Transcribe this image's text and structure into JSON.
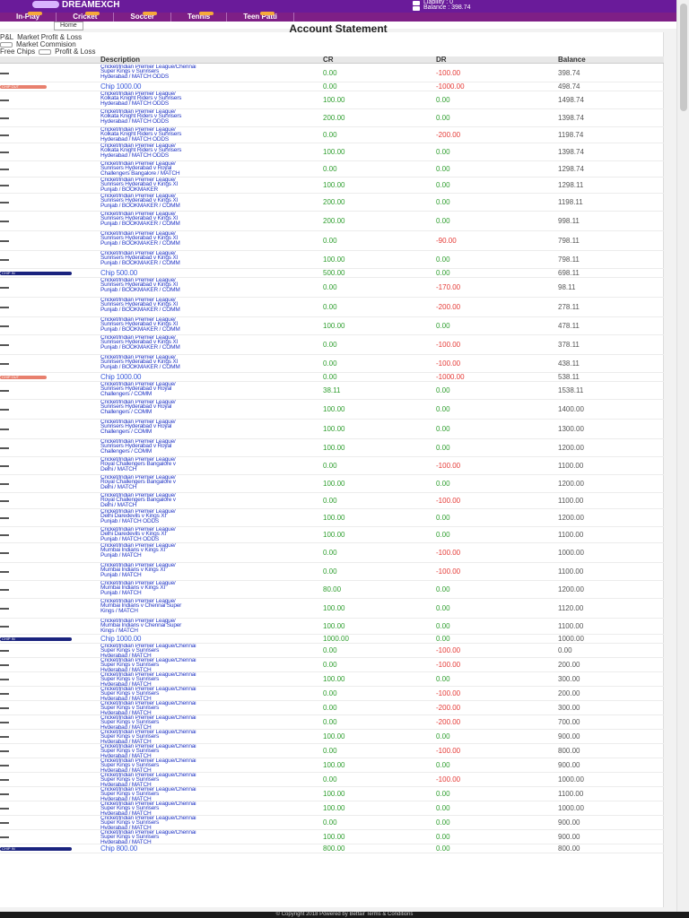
{
  "brand": {
    "name": "DREAMEXCH"
  },
  "header": {
    "liability": "Liability : 0",
    "balance": "Balance : 398.74"
  },
  "nav": [
    "In-Play",
    "Cricket",
    "Soccer",
    "Tennis",
    "Teen Patti"
  ],
  "subnav": {
    "tab": "Home"
  },
  "page": {
    "title": "Account Statement"
  },
  "filters": {
    "market_pl": "Market Profit & Loss",
    "market_commission": "Market Commision",
    "free_chips": "Free Chips",
    "pl": "Profit & Loss",
    "free_chips_pl": "Free Chips",
    "pl_short": "P&L"
  },
  "table": {
    "headers": {
      "description": "Description",
      "cr": "CR",
      "dr": "DR",
      "balance": "Balance"
    },
    "rows": [
      {
        "date": "",
        "badge": "",
        "desc": "Cricket/Indian Premier League/Chennai\nSuper Kings v Sunrisers\nHyderabad / MATCH ODDS",
        "cr": "0.00",
        "dr": "-100.00",
        "balance": "398.74",
        "h": 20
      },
      {
        "date": "",
        "badge": "red",
        "badge_text": "CHIP OUT",
        "desc": "Chip 1000.00",
        "chip": true,
        "cr": "0.00",
        "dr": "-1000.00",
        "balance": "498.74",
        "h": 10
      },
      {
        "date": "",
        "badge": "",
        "desc": "Cricket/Indian Premier League/\nKolkata Knight Riders v Sunrisers\nHyderabad / MATCH ODDS",
        "cr": "100.00",
        "dr": "0.00",
        "balance": "1498.74",
        "h": 20
      },
      {
        "date": "",
        "badge": "",
        "desc": "Cricket/Indian Premier League/\nKolkata Knight Riders v Sunrisers\nHyderabad / MATCH ODDS",
        "cr": "200.00",
        "dr": "0.00",
        "balance": "1398.74",
        "h": 20
      },
      {
        "date": "",
        "badge": "",
        "desc": "Cricket/Indian Premier League/\nKolkata Knight Riders v Sunrisers\nHyderabad / MATCH ODDS",
        "cr": "0.00",
        "dr": "-200.00",
        "balance": "1198.74",
        "h": 18
      },
      {
        "date": "",
        "badge": "",
        "desc": "Cricket/Indian Premier League/\nKolkata Knight Riders v Sunrisers\nHyderabad / MATCH ODDS",
        "cr": "100.00",
        "dr": "0.00",
        "balance": "1398.74",
        "h": 20
      },
      {
        "date": "",
        "badge": "",
        "desc": "Cricket/Indian Premier League/\nSunrisers Hyderabad v Royal\nChallengers Bangalore / MATCH",
        "cr": "0.00",
        "dr": "0.00",
        "balance": "1298.74",
        "h": 18
      },
      {
        "date": "",
        "badge": "",
        "desc": "Cricket/Indian Premier League/\nSunrisers Hyderabad v Kings XI\nPunjab / BOOKMAKER",
        "cr": "100.00",
        "dr": "0.00",
        "balance": "1298.11",
        "h": 18
      },
      {
        "date": "",
        "badge": "",
        "desc": "Cricket/Indian Premier League/\nSunrisers Hyderabad v Kings XI\nPunjab / BOOKMAKER / COMM",
        "cr": "200.00",
        "dr": "0.00",
        "balance": "1198.11",
        "h": 20
      },
      {
        "date": "",
        "badge": "",
        "desc": "Cricket/Indian Premier League/\nSunrisers Hyderabad v Kings XI\nPunjab / BOOKMAKER / COMM",
        "cr": "200.00",
        "dr": "0.00",
        "balance": "998.11",
        "h": 22
      },
      {
        "date": "",
        "badge": "",
        "desc": "Cricket/Indian Premier League/\nSunrisers Hyderabad v Kings XI\nPunjab / BOOKMAKER / COMM",
        "cr": "0.00",
        "dr": "-90.00",
        "balance": "798.11",
        "h": 22
      },
      {
        "date": "",
        "badge": "",
        "desc": "Cricket/Indian Premier League/\nSunrisers Hyderabad v Kings XI\nPunjab / BOOKMAKER / COMM",
        "cr": "100.00",
        "dr": "0.00",
        "balance": "798.11",
        "h": 20
      },
      {
        "date": "",
        "badge": "blue",
        "badge_text": "CHIP IN",
        "desc": "Chip 500.00",
        "chip": true,
        "cr": "500.00",
        "dr": "0.00",
        "balance": "698.11",
        "h": 10
      },
      {
        "date": "",
        "badge": "",
        "desc": "Cricket/Indian Premier League/\nSunrisers Hyderabad v Kings XI\nPunjab / BOOKMAKER / COMM",
        "cr": "0.00",
        "dr": "-170.00",
        "balance": "98.11",
        "h": 22
      },
      {
        "date": "",
        "badge": "",
        "desc": "Cricket/Indian Premier League/\nSunrisers Hyderabad v Kings XI\nPunjab / BOOKMAKER / COMM",
        "cr": "0.00",
        "dr": "-200.00",
        "balance": "278.11",
        "h": 22
      },
      {
        "date": "",
        "badge": "",
        "desc": "Cricket/Indian Premier League/\nSunrisers Hyderabad v Kings XI\nPunjab / BOOKMAKER / COMM",
        "cr": "100.00",
        "dr": "0.00",
        "balance": "478.11",
        "h": 20
      },
      {
        "date": "",
        "badge": "",
        "desc": "Cricket/Indian Premier League/\nSunrisers Hyderabad v Kings XI\nPunjab / BOOKMAKER / COMM",
        "cr": "0.00",
        "dr": "-100.00",
        "balance": "378.11",
        "h": 22
      },
      {
        "date": "",
        "badge": "",
        "desc": "Cricket/Indian Premier League/\nSunrisers Hyderabad v Kings XI\nPunjab / BOOKMAKER / COMM",
        "cr": "0.00",
        "dr": "-100.00",
        "balance": "438.11",
        "h": 20
      },
      {
        "date": "",
        "badge": "red",
        "badge_text": "CHIP OUT",
        "desc": "Chip 1000.00",
        "chip": true,
        "cr": "0.00",
        "dr": "-1000.00",
        "balance": "538.11",
        "h": 10
      },
      {
        "date": "",
        "badge": "",
        "desc": "Cricket/Indian Premier League/\nSunrisers Hyderabad v Royal\nChallengers / COMM",
        "cr": "38.11",
        "dr": "0.00",
        "balance": "1538.11",
        "h": 20
      },
      {
        "date": "",
        "badge": "",
        "desc": "Cricket/Indian Premier League/\nSunrisers Hyderabad v Royal\nChallengers / COMM",
        "cr": "100.00",
        "dr": "0.00",
        "balance": "1400.00",
        "h": 22
      },
      {
        "date": "",
        "badge": "",
        "desc": "Cricket/Indian Premier League/\nSunrisers Hyderabad v Royal\nChallengers / COMM",
        "cr": "100.00",
        "dr": "0.00",
        "balance": "1300.00",
        "h": 22
      },
      {
        "date": "",
        "badge": "",
        "desc": "Cricket/Indian Premier League/\nSunrisers Hyderabad v Royal\nChallengers / COMM",
        "cr": "100.00",
        "dr": "0.00",
        "balance": "1200.00",
        "h": 20
      },
      {
        "date": "",
        "badge": "",
        "desc": "Cricket/Indian Premier League/\nRoyal Challengers Bangalore v\nDelhi / MATCH",
        "cr": "0.00",
        "dr": "-100.00",
        "balance": "1100.00",
        "h": 20
      },
      {
        "date": "",
        "badge": "",
        "desc": "Cricket/Indian Premier League/\nRoyal Challengers Bangalore v\nDelhi / MATCH",
        "cr": "100.00",
        "dr": "0.00",
        "balance": "1200.00",
        "h": 20
      },
      {
        "date": "",
        "badge": "",
        "desc": "Cricket/Indian Premier League/\nRoyal Challengers Bangalore v\nDelhi / MATCH",
        "cr": "0.00",
        "dr": "-100.00",
        "balance": "1100.00",
        "h": 18
      },
      {
        "date": "",
        "badge": "",
        "desc": "Cricket/Indian Premier League/\nDelhi Daredevils v Kings XI\nPunjab / MATCH ODDS",
        "cr": "100.00",
        "dr": "0.00",
        "balance": "1200.00",
        "h": 20
      },
      {
        "date": "",
        "badge": "",
        "desc": "Cricket/Indian Premier League/\nDelhi Daredevils v Kings XI\nPunjab / MATCH ODDS",
        "cr": "100.00",
        "dr": "0.00",
        "balance": "1100.00",
        "h": 18
      },
      {
        "date": "",
        "badge": "",
        "desc": "Cricket/Indian Premier League/\nMumbai Indians v Kings XI\nPunjab / MATCH",
        "cr": "0.00",
        "dr": "-100.00",
        "balance": "1000.00",
        "h": 22
      },
      {
        "date": "",
        "badge": "",
        "desc": "Cricket/Indian Premier League/\nMumbai Indians v Kings XI\nPunjab / MATCH",
        "cr": "0.00",
        "dr": "-100.00",
        "balance": "1100.00",
        "h": 20
      },
      {
        "date": "",
        "badge": "",
        "desc": "Cricket/Indian Premier League/\nMumbai Indians v Kings XI\nPunjab / MATCH",
        "cr": "80.00",
        "dr": "0.00",
        "balance": "1200.00",
        "h": 20
      },
      {
        "date": "",
        "badge": "",
        "desc": "Cricket/Indian Premier League/\nMumbai Indians v Chennai Super\nKings / MATCH",
        "cr": "100.00",
        "dr": "0.00",
        "balance": "1120.00",
        "h": 22
      },
      {
        "date": "",
        "badge": "",
        "desc": "Cricket/Indian Premier League/\nMumbai Indians v Chennai Super\nKings / MATCH",
        "cr": "100.00",
        "dr": "0.00",
        "balance": "1100.00",
        "h": 18
      },
      {
        "date": "",
        "badge": "blue",
        "badge_text": "CHIP IN",
        "desc": "Chip 1000.00",
        "chip": true,
        "cr": "1000.00",
        "dr": "0.00",
        "balance": "1000.00",
        "h": 10
      },
      {
        "date": "",
        "badge": "",
        "desc": "Cricket/Indian Premier League/Chennai\nSuper Kings v Sunrisers\nHyderabad / MATCH",
        "cr": "0.00",
        "dr": "-100.00",
        "balance": "0.00",
        "h": 16
      },
      {
        "date": "",
        "badge": "",
        "desc": "Cricket/Indian Premier League/Chennai\nSuper Kings v Sunrisers\nHyderabad / MATCH",
        "cr": "0.00",
        "dr": "-100.00",
        "balance": "200.00",
        "h": 16
      },
      {
        "date": "",
        "badge": "",
        "desc": "Cricket/Indian Premier League/Chennai\nSuper Kings v Sunrisers\nHyderabad / MATCH",
        "cr": "100.00",
        "dr": "0.00",
        "balance": "300.00",
        "h": 16
      },
      {
        "date": "",
        "badge": "",
        "desc": "Cricket/Indian Premier League/Chennai\nSuper Kings v Sunrisers\nHyderabad / MATCH",
        "cr": "0.00",
        "dr": "-100.00",
        "balance": "200.00",
        "h": 16
      },
      {
        "date": "",
        "badge": "",
        "desc": "Cricket/Indian Premier League/Chennai\nSuper Kings v Sunrisers\nHyderabad / MATCH",
        "cr": "0.00",
        "dr": "-200.00",
        "balance": "300.00",
        "h": 16
      },
      {
        "date": "",
        "badge": "",
        "desc": "Cricket/Indian Premier League/Chennai\nSuper Kings v Sunrisers\nHyderabad / MATCH",
        "cr": "0.00",
        "dr": "-200.00",
        "balance": "700.00",
        "h": 16
      },
      {
        "date": "",
        "badge": "",
        "desc": "Cricket/Indian Premier League/Chennai\nSuper Kings v Sunrisers\nHyderabad / MATCH",
        "cr": "100.00",
        "dr": "0.00",
        "balance": "900.00",
        "h": 16
      },
      {
        "date": "",
        "badge": "",
        "desc": "Cricket/Indian Premier League/Chennai\nSuper Kings v Sunrisers\nHyderabad / MATCH",
        "cr": "0.00",
        "dr": "-100.00",
        "balance": "800.00",
        "h": 16
      },
      {
        "date": "",
        "badge": "",
        "desc": "Cricket/Indian Premier League/Chennai\nSuper Kings v Sunrisers\nHyderabad / MATCH",
        "cr": "100.00",
        "dr": "0.00",
        "balance": "900.00",
        "h": 16
      },
      {
        "date": "",
        "badge": "",
        "desc": "Cricket/Indian Premier League/Chennai\nSuper Kings v Sunrisers\nHyderabad / MATCH",
        "cr": "0.00",
        "dr": "-100.00",
        "balance": "1000.00",
        "h": 16
      },
      {
        "date": "",
        "badge": "",
        "desc": "Cricket/Indian Premier League/Chennai\nSuper Kings v Sunrisers\nHyderabad / MATCH",
        "cr": "100.00",
        "dr": "0.00",
        "balance": "1100.00",
        "h": 16
      },
      {
        "date": "",
        "badge": "",
        "desc": "Cricket/Indian Premier League/Chennai\nSuper Kings v Sunrisers\nHyderabad / MATCH",
        "cr": "100.00",
        "dr": "0.00",
        "balance": "1000.00",
        "h": 16
      },
      {
        "date": "",
        "badge": "",
        "desc": "Cricket/Indian Premier League/Chennai\nSuper Kings v Sunrisers\nHyderabad / MATCH",
        "cr": "0.00",
        "dr": "0.00",
        "balance": "900.00",
        "h": 16
      },
      {
        "date": "",
        "badge": "",
        "desc": "Cricket/Indian Premier League/Chennai\nSuper Kings v Sunrisers\nHyderabad / MATCH",
        "cr": "100.00",
        "dr": "0.00",
        "balance": "900.00",
        "h": 16
      },
      {
        "date": "",
        "badge": "blue",
        "badge_text": "CHIP IN",
        "desc": "Chip 800.00",
        "chip": true,
        "cr": "800.00",
        "dr": "0.00",
        "balance": "800.00",
        "h": 10
      }
    ]
  },
  "footer": {
    "text": "© Copyright 2018 Powered by Betfair Terms & Conditions"
  },
  "colors": {
    "brand_purple": "#6a1b9a",
    "credit_green": "#2e9e2e",
    "debit_red": "#e53935",
    "link_blue": "#2337c6",
    "chip_in": "#1a237e",
    "chip_out": "#e8806e"
  }
}
